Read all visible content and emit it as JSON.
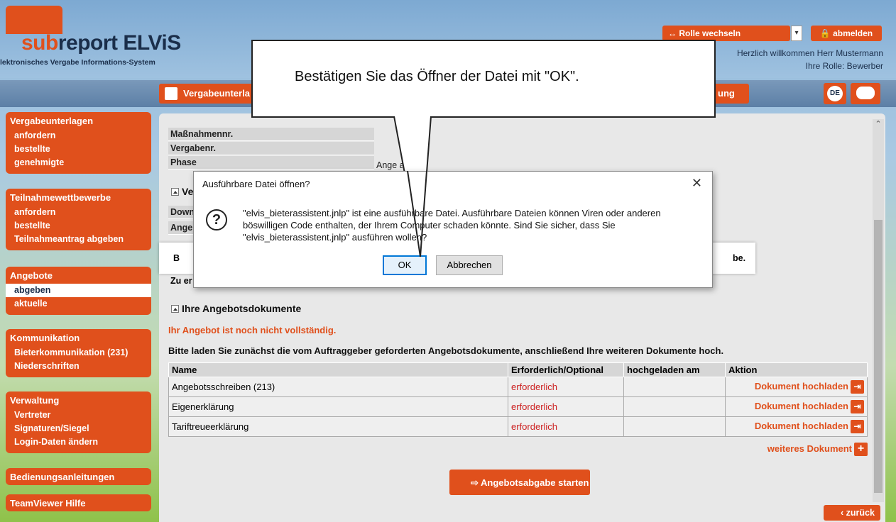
{
  "header": {
    "logo_sub": "sub",
    "logo_main": "report ELViS",
    "logo_tagline": "lektronisches Vergabe Informations-System",
    "role_switch_label": "↔ Rolle wechseln",
    "logout_label": "abmelden",
    "welcome": "Herzlich willkommen Herr Mustermann",
    "role": "Ihre Rolle: Bewerber"
  },
  "nav": {
    "tab_vergabe": "Vergabeunterla",
    "tab_partial": "ung",
    "lang": "DE"
  },
  "sidebar": {
    "groups": [
      {
        "title": "Vergabeunterlagen",
        "items": [
          "anfordern",
          "bestellte",
          "genehmigte"
        ]
      },
      {
        "title": "Teilnahmewettbewerbe",
        "items": [
          "anfordern",
          "bestellte",
          "Teilnahmeantrag abgeben"
        ]
      },
      {
        "title": "Angebote",
        "items": [
          "abgeben",
          "aktuelle"
        ]
      },
      {
        "title": "Kommunikation",
        "items": [
          "Bieterkommunikation (231)",
          "Niederschriften"
        ]
      },
      {
        "title": "Verwaltung",
        "items": [
          "Vertreter",
          "Signaturen/Siegel",
          "Login-Daten ändern"
        ]
      },
      {
        "title": "Bedienungsanleitungen",
        "items": []
      },
      {
        "title": "TeamViewer Hilfe",
        "items": []
      }
    ]
  },
  "details": {
    "rows": [
      {
        "label": "Maßnahmennr.",
        "value": ""
      },
      {
        "label": "Vergabenr.",
        "value": ""
      },
      {
        "label": "Phase",
        "value": "Ange          ase"
      }
    ],
    "section_v": "Ve",
    "row_down": "Down",
    "row_ange": "Ange",
    "banner_left": "B",
    "banner_right": "be.",
    "row_zu": "Zu er"
  },
  "docs": {
    "section_title": "Ihre Angebotsdokumente",
    "warning": "Ihr Angebot ist noch nicht vollständig.",
    "info": "Bitte laden Sie zunächst die vom Auftraggeber geforderten Angebotsdokumente, anschließend Ihre weiteren Dokumente hoch.",
    "columns": [
      "Name",
      "Erforderlich/Optional",
      "hochgeladen am",
      "Aktion"
    ],
    "rows": [
      {
        "name": "Angebotsschreiben (213)",
        "req": "erforderlich",
        "date": "",
        "action": "Dokument hochladen"
      },
      {
        "name": "Eigenerklärung",
        "req": "erforderlich",
        "date": "",
        "action": "Dokument hochladen"
      },
      {
        "name": "Tariftreueerklärung",
        "req": "erforderlich",
        "date": "",
        "action": "Dokument hochladen"
      }
    ],
    "more_doc": "weiteres Dokument",
    "start_button": "Angebotsabgabe starten",
    "back_button": "zurück"
  },
  "callout": {
    "text": "Bestätigen Sie das Öffner der Datei mit \"OK\"."
  },
  "dialog": {
    "title": "Ausführbare Datei öffnen?",
    "message": "\"elvis_bieterassistent.jnlp\" ist eine ausführbare Datei. Ausführbare Dateien können Viren oder anderen böswilligen Code enthalten, der Ihrem Computer schaden könnte. Sind Sie sicher, dass Sie \"elvis_bieterassistent.jnlp\" ausführen wollen?",
    "ok": "OK",
    "cancel": "Abbrechen"
  },
  "colors": {
    "accent": "#e0501c",
    "required": "#cc1f1f"
  }
}
